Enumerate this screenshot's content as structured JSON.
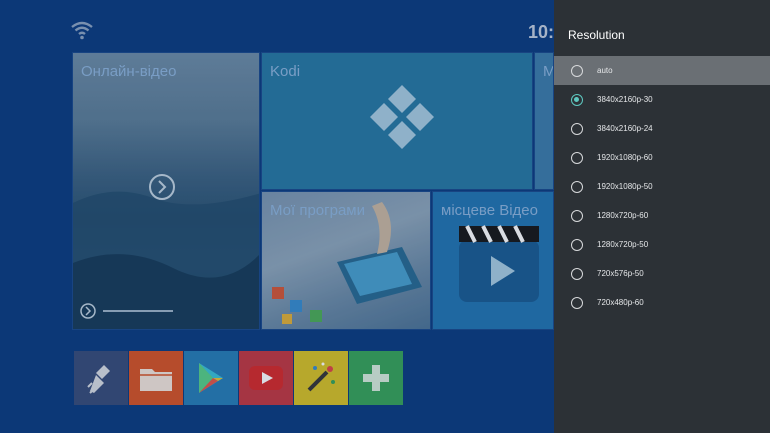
{
  "launcher": {
    "clock": "10:",
    "tiles": {
      "online_video": "Онлайн-відео",
      "kodi": "Kodi",
      "extra": "M",
      "my_apps": "Мої програми",
      "local_video": "місцеве Відео"
    },
    "apps": [
      {
        "icon": "cleaner-icon",
        "color": "#3a4f7c"
      },
      {
        "icon": "folder-icon",
        "color": "#d6562a"
      },
      {
        "icon": "play-store-icon",
        "color": "#2a7fb8"
      },
      {
        "icon": "youtube-icon",
        "color": "#c23b45"
      },
      {
        "icon": "magic-wand-icon",
        "color": "#d8c22a"
      },
      {
        "icon": "add-icon",
        "color": "#3aa55c"
      }
    ]
  },
  "resolution_panel": {
    "title": "Resolution",
    "options": [
      {
        "label": "auto",
        "highlighted": true,
        "checked": false
      },
      {
        "label": "3840x2160p-30",
        "highlighted": false,
        "checked": true
      },
      {
        "label": "3840x2160p-24",
        "highlighted": false,
        "checked": false
      },
      {
        "label": "1920x1080p-60",
        "highlighted": false,
        "checked": false
      },
      {
        "label": "1920x1080p-50",
        "highlighted": false,
        "checked": false
      },
      {
        "label": "1280x720p-60",
        "highlighted": false,
        "checked": false
      },
      {
        "label": "1280x720p-50",
        "highlighted": false,
        "checked": false
      },
      {
        "label": "720x576p-50",
        "highlighted": false,
        "checked": false
      },
      {
        "label": "720x480p-60",
        "highlighted": false,
        "checked": false
      }
    ]
  },
  "colors": {
    "panel_bg": "#2c3136",
    "highlight_bg": "#6a6f74",
    "radio_checked": "#5ec8c0",
    "launcher_bg": "#0f3f82"
  }
}
